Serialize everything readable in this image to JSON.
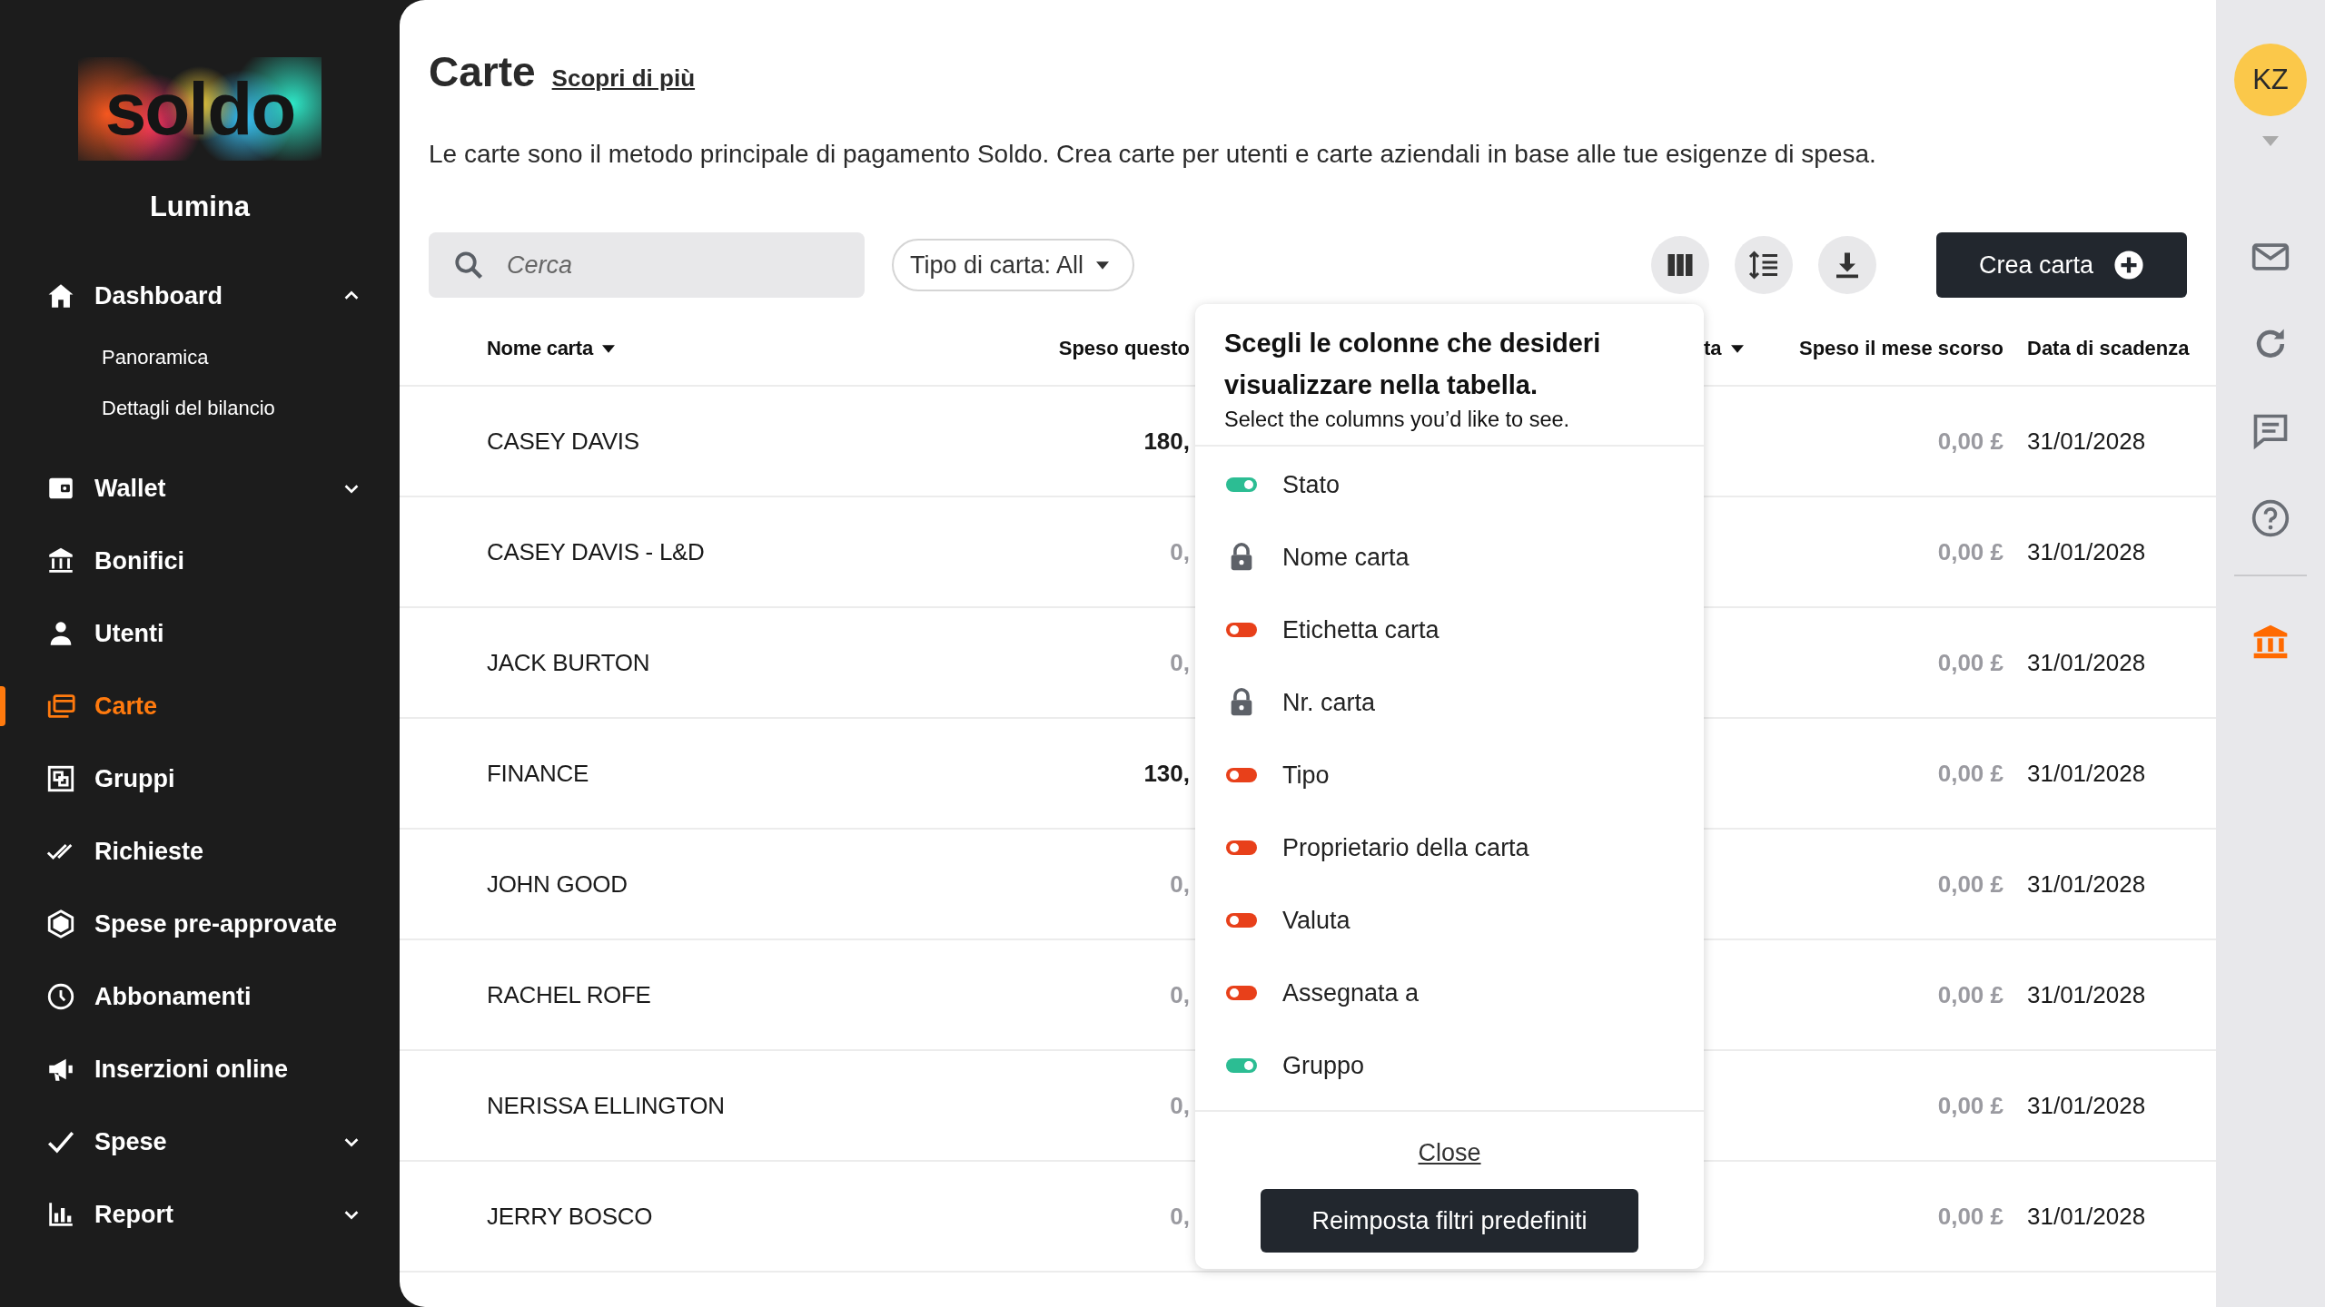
{
  "sidebar": {
    "logo": "soldo",
    "company": "Lumina",
    "items": [
      {
        "label": "Dashboard",
        "kind": "group",
        "expanded": true,
        "selected": false,
        "children": [
          {
            "label": "Panoramica"
          },
          {
            "label": "Dettagli del bilancio"
          }
        ]
      },
      {
        "label": "Wallet",
        "kind": "group",
        "expanded": false,
        "selected": false
      },
      {
        "label": "Bonifici",
        "kind": "link",
        "selected": false
      },
      {
        "label": "Utenti",
        "kind": "link",
        "selected": false
      },
      {
        "label": "Carte",
        "kind": "link",
        "selected": true
      },
      {
        "label": "Gruppi",
        "kind": "link",
        "selected": false
      },
      {
        "label": "Richieste",
        "kind": "link",
        "selected": false
      },
      {
        "label": "Spese pre-approvate",
        "kind": "link",
        "selected": false
      },
      {
        "label": "Abbonamenti",
        "kind": "link",
        "selected": false
      },
      {
        "label": "Inserzioni online",
        "kind": "link",
        "selected": false
      },
      {
        "label": "Spese",
        "kind": "group",
        "expanded": false,
        "selected": false
      },
      {
        "label": "Report",
        "kind": "group",
        "expanded": false,
        "selected": false
      }
    ]
  },
  "header": {
    "title": "Carte",
    "learn_more": "Scopri di più",
    "description": "Le carte sono il metodo principale di pagamento Soldo. Crea carte per utenti e carte aziendali in base alle tue esigenze di spesa."
  },
  "toolbar": {
    "search": {
      "placeholder": "Cerca"
    },
    "filter": "Tipo di carta: All",
    "create_button": "Crea carta"
  },
  "table": {
    "columns": [
      {
        "label": "Nome carta",
        "sort_indicator": true
      },
      {
        "label": "Speso questo",
        "sort_indicator": false
      },
      {
        "label": "ta",
        "sort_indicator": true
      },
      {
        "label": "Speso il mese scorso",
        "sort_indicator": false
      },
      {
        "label": "Data di scadenza",
        "sort_indicator": false
      }
    ],
    "rows": [
      {
        "name": "CASEY DAVIS",
        "spent": "180,",
        "spent_muted": false,
        "last_month": "0,00 £",
        "expiry": "31/01/2028"
      },
      {
        "name": "CASEY DAVIS - L&D",
        "spent": "0,",
        "spent_muted": true,
        "last_month": "0,00 £",
        "expiry": "31/01/2028"
      },
      {
        "name": "JACK BURTON",
        "spent": "0,",
        "spent_muted": true,
        "last_month": "0,00 £",
        "expiry": "31/01/2028"
      },
      {
        "name": "FINANCE",
        "spent": "130,",
        "spent_muted": false,
        "last_month": "0,00 £",
        "expiry": "31/01/2028"
      },
      {
        "name": "JOHN GOOD",
        "spent": "0,",
        "spent_muted": true,
        "last_month": "0,00 £",
        "expiry": "31/01/2028"
      },
      {
        "name": "RACHEL ROFE",
        "spent": "0,",
        "spent_muted": true,
        "last_month": "0,00 £",
        "expiry": "31/01/2028"
      },
      {
        "name": "NERISSA ELLINGTON",
        "spent": "0,",
        "spent_muted": true,
        "last_month": "0,00 £",
        "expiry": "31/01/2028"
      },
      {
        "name": "JERRY BOSCO",
        "spent": "0,",
        "spent_muted": true,
        "last_month": "0,00 £",
        "expiry": "31/01/2028"
      }
    ]
  },
  "column_picker": {
    "title": "Scegli le colonne che desideri visualizzare nella tabella.",
    "subtitle": "Select the columns you’d like to see.",
    "items": [
      {
        "label": "Stato",
        "kind": "toggle",
        "on": true
      },
      {
        "label": "Nome carta",
        "kind": "locked"
      },
      {
        "label": "Etichetta carta",
        "kind": "toggle",
        "on": false
      },
      {
        "label": "Nr. carta",
        "kind": "locked"
      },
      {
        "label": "Tipo",
        "kind": "toggle",
        "on": false
      },
      {
        "label": "Proprietario della carta",
        "kind": "toggle",
        "on": false
      },
      {
        "label": "Valuta",
        "kind": "toggle",
        "on": false
      },
      {
        "label": "Assegnata a",
        "kind": "toggle",
        "on": false
      },
      {
        "label": "Gruppo",
        "kind": "toggle",
        "on": true
      }
    ],
    "close": "Close",
    "reset_button": "Reimposta filtri predefiniti"
  },
  "rail": {
    "avatar": "KZ"
  }
}
